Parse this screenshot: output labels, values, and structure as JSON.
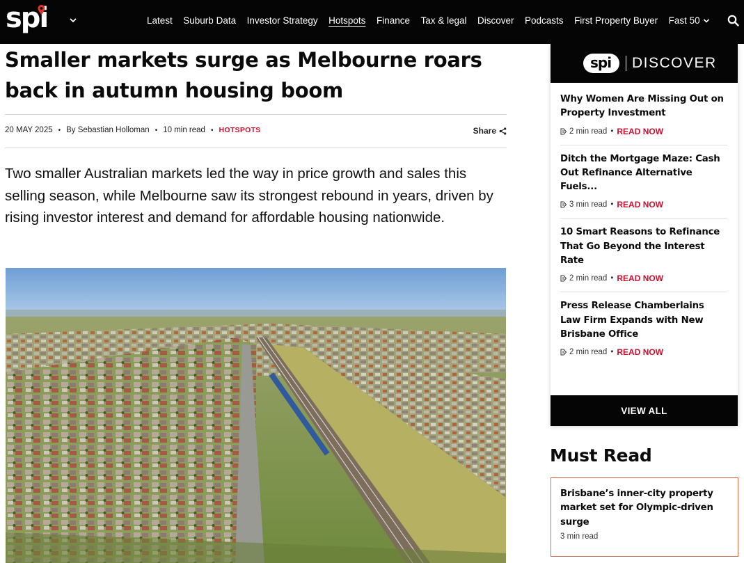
{
  "header": {
    "logo_text": "spi",
    "nav": [
      {
        "label": "Latest"
      },
      {
        "label": "Suburb Data"
      },
      {
        "label": "Investor Strategy"
      },
      {
        "label": "Hotspots",
        "active": true
      },
      {
        "label": "Finance"
      },
      {
        "label": "Tax & legal"
      },
      {
        "label": "Discover"
      },
      {
        "label": "Podcasts"
      },
      {
        "label": "First Property Buyer"
      },
      {
        "label": "Fast 50",
        "has_dropdown": true
      }
    ]
  },
  "article": {
    "headline": "Smaller markets surge as Melbourne roars back in autumn housing boom",
    "date": "20 MAY 2025",
    "author": "By Sebastian Holloman",
    "read_time": "10 min read",
    "category": "HOTSPOTS",
    "share_label": "Share",
    "lede": "Two smaller Australian markets led the way in price growth and sales this selling season, while Melbourne saw its strongest rebound in years, driven by rising investor interest and demand for affordable housing nationwide."
  },
  "discover": {
    "logo_text": "spi",
    "brand_word": "DISCOVER",
    "items": [
      {
        "title": "Why Women Are Missing Out on Property Investment",
        "read_time": "2 min read",
        "cta": "READ NOW"
      },
      {
        "title": "Ditch the Mortgage Maze: Cash Out Refinance Alternative Fuels...",
        "read_time": "3 min read",
        "cta": "READ NOW"
      },
      {
        "title": "10 Smart Reasons to Refinance That Go Beyond the Interest Rate",
        "read_time": "2 min read",
        "cta": "READ NOW"
      },
      {
        "title": "Press Release Chamberlains Law Firm Expands with New Brisbane Office",
        "read_time": "2 min read",
        "cta": "READ NOW"
      }
    ],
    "view_all_label": "VIEW ALL"
  },
  "must_read": {
    "heading": "Must Read",
    "items": [
      {
        "title": "Brisbane’s inner-city property market set for Olympic-driven surge",
        "read_time": "3 min read"
      }
    ]
  },
  "colors": {
    "header_bg": "#050505",
    "accent_red": "#c8102e",
    "logo_pin": "#e0322b",
    "card_border": "#d86a4a"
  }
}
